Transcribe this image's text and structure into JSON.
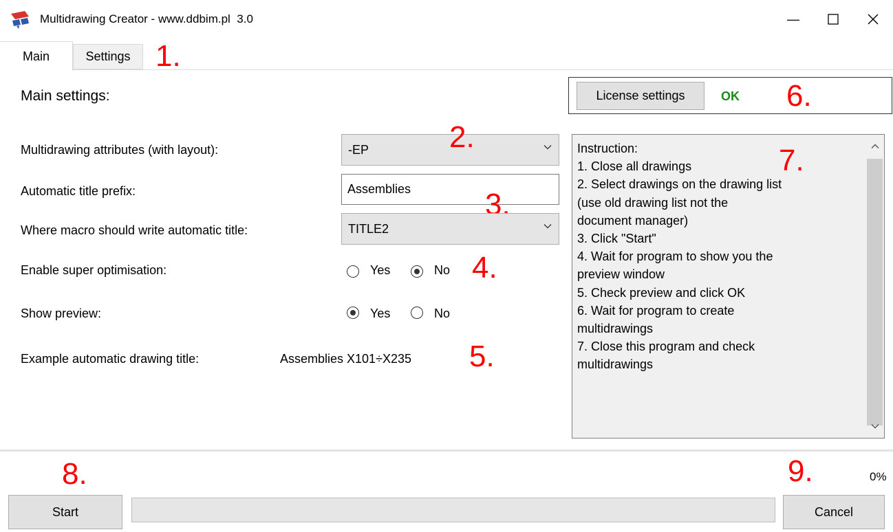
{
  "window": {
    "title": "Multidrawing Creator - www.ddbim.pl",
    "version": "3.0",
    "minimize_glyph": "—",
    "maximize_glyph": "☐",
    "close_glyph": "✕"
  },
  "tabs": [
    {
      "label": "Main",
      "active": true
    },
    {
      "label": "Settings",
      "active": false
    }
  ],
  "annotations": [
    "1.",
    "2.",
    "3.",
    "4.",
    "5.",
    "6.",
    "7.",
    "8.",
    "9."
  ],
  "main": {
    "heading": "Main settings:",
    "attributes_label": "Multidrawing attributes (with layout):",
    "attributes_value": "-EP",
    "prefix_label": "Automatic title prefix:",
    "prefix_value": "Assemblies",
    "title_target_label": "Where macro should write automatic title:",
    "title_target_value": "TITLE2",
    "optimisation_label": "Enable super optimisation:",
    "optimisation_yes": "Yes",
    "optimisation_no": "No",
    "optimisation_selected": "No",
    "preview_label": "Show preview:",
    "preview_yes": "Yes",
    "preview_no": "No",
    "preview_selected": "Yes",
    "example_label": "Example automatic drawing title:",
    "example_value": "Assemblies X101÷X235"
  },
  "license": {
    "button_label": "License settings",
    "status": "OK",
    "status_color": "#1a8a1a"
  },
  "instruction": {
    "lines": [
      "Instruction:",
      "1. Close all drawings",
      "2. Select drawings on the drawing list",
      "(use old drawing list not the",
      "document manager)",
      "3. Click \"Start\"",
      "4. Wait for program to show you the",
      "preview window",
      "5. Check preview and click OK",
      "6. Wait for program to create",
      "multidrawings",
      "7. Close this program and check",
      "multidrawings"
    ]
  },
  "bottom": {
    "start_label": "Start",
    "cancel_label": "Cancel",
    "progress_text": "0%",
    "progress_value": 0
  },
  "colors": {
    "annotation_red": "#ff0000",
    "icon_red": "#d9342b",
    "icon_blue": "#2f5aa8"
  },
  "icons": {
    "app": "red-blue-pencil-logo-icon",
    "combo_arrow": "chevron-down-icon",
    "scroll_up": "chevron-up-icon",
    "scroll_down": "chevron-down-icon"
  }
}
